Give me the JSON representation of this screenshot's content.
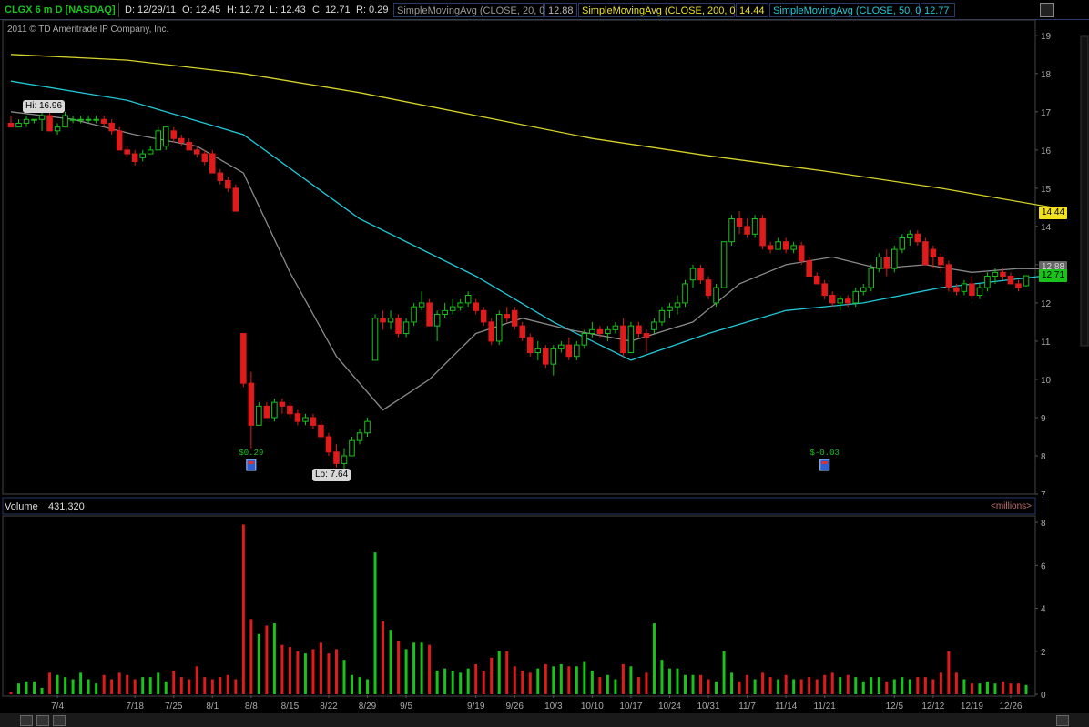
{
  "header": {
    "symbol": "CLGX 6 m D [NASDAQ]",
    "date": "D: 12/29/11",
    "open": "O: 12.45",
    "high": "H: 12.72",
    "low": "L: 12.43",
    "close": "C: 12.71",
    "range": "R: 0.29",
    "sma20_label": "SimpleMovingAvg (CLOSE, 20, 0)",
    "sma20_value": "12.88",
    "sma200_label": "SimpleMovingAvg (CLOSE, 200, 0)",
    "sma200_value": "14.44",
    "sma50_label": "SimpleMovingAvg (CLOSE, 50, 0)",
    "sma50_value": "12.77"
  },
  "copyright": "2011 © TD Ameritrade IP Company, Inc.",
  "colors": {
    "up": "#19c319",
    "down": "#e01b1b",
    "sma20": "#8a8a8a",
    "sma50": "#22c8d8",
    "sma200": "#d6d22a",
    "grid": "#555555"
  },
  "volume_panel": {
    "label": "Volume",
    "value": "431,320",
    "units": "<millions>"
  },
  "annotations": {
    "hi_label": "Hi: 16.96",
    "lo_label": "Lo: 7.64",
    "earnings1": "$0.29",
    "earnings2": "$-0.03",
    "price_tag_200": "14.44",
    "price_tag_20": "12.88",
    "price_tag_close": "12.71"
  },
  "chart_data": {
    "type": "candlestick",
    "price_ylim": [
      7,
      19.4
    ],
    "price_yticks": [
      7,
      8,
      9,
      10,
      11,
      12,
      13,
      14,
      15,
      16,
      17,
      18,
      19
    ],
    "volume_ylim": [
      0,
      8.3
    ],
    "volume_yticks": [
      0,
      2,
      4,
      6,
      8
    ],
    "x_labels": [
      {
        "i": 6,
        "t": "7/4"
      },
      {
        "i": 16,
        "t": "7/18"
      },
      {
        "i": 21,
        "t": "7/25"
      },
      {
        "i": 26,
        "t": "8/1"
      },
      {
        "i": 31,
        "t": "8/8"
      },
      {
        "i": 36,
        "t": "8/15"
      },
      {
        "i": 41,
        "t": "8/22"
      },
      {
        "i": 46,
        "t": "8/29"
      },
      {
        "i": 51,
        "t": "9/5"
      },
      {
        "i": 60,
        "t": "9/19"
      },
      {
        "i": 65,
        "t": "9/26"
      },
      {
        "i": 70,
        "t": "10/3"
      },
      {
        "i": 75,
        "t": "10/10"
      },
      {
        "i": 80,
        "t": "10/17"
      },
      {
        "i": 85,
        "t": "10/24"
      },
      {
        "i": 90,
        "t": "10/31"
      },
      {
        "i": 95,
        "t": "11/7"
      },
      {
        "i": 100,
        "t": "11/14"
      },
      {
        "i": 105,
        "t": "11/21"
      },
      {
        "i": 114,
        "t": "12/5"
      },
      {
        "i": 119,
        "t": "12/12"
      },
      {
        "i": 124,
        "t": "12/19"
      },
      {
        "i": 129,
        "t": "12/26"
      }
    ],
    "candles": [
      [
        16.7,
        16.9,
        16.6,
        16.6,
        0.1
      ],
      [
        16.6,
        16.8,
        16.6,
        16.7,
        0.5
      ],
      [
        16.7,
        16.9,
        16.6,
        16.8,
        0.6
      ],
      [
        16.8,
        16.8,
        16.7,
        16.8,
        0.6
      ],
      [
        16.8,
        17.0,
        16.5,
        16.9,
        0.3
      ],
      [
        16.9,
        17.0,
        16.5,
        16.5,
        1.0
      ],
      [
        16.5,
        16.7,
        16.4,
        16.6,
        0.9
      ],
      [
        16.6,
        17.0,
        16.6,
        16.9,
        0.8
      ],
      [
        16.8,
        16.9,
        16.7,
        16.8,
        0.7
      ],
      [
        16.8,
        16.9,
        16.7,
        16.8,
        1.0
      ],
      [
        16.8,
        16.9,
        16.7,
        16.8,
        0.7
      ],
      [
        16.8,
        16.9,
        16.7,
        16.8,
        0.5
      ],
      [
        16.8,
        16.9,
        16.6,
        16.7,
        0.9
      ],
      [
        16.7,
        16.8,
        16.4,
        16.5,
        0.7
      ],
      [
        16.5,
        16.6,
        16.0,
        16.0,
        1.0
      ],
      [
        16.0,
        16.1,
        15.8,
        15.9,
        0.9
      ],
      [
        15.9,
        16.0,
        15.6,
        15.7,
        0.7
      ],
      [
        15.8,
        16.0,
        15.7,
        15.9,
        0.8
      ],
      [
        15.9,
        16.1,
        15.9,
        16.0,
        0.8
      ],
      [
        16.0,
        16.6,
        16.0,
        16.5,
        1.0
      ],
      [
        16.1,
        16.6,
        16.0,
        16.6,
        0.6
      ],
      [
        16.5,
        16.6,
        16.2,
        16.3,
        1.1
      ],
      [
        16.3,
        16.4,
        16.1,
        16.2,
        0.8
      ],
      [
        16.2,
        16.3,
        16.0,
        16.0,
        0.7
      ],
      [
        16.0,
        16.1,
        15.8,
        15.9,
        1.3
      ],
      [
        15.9,
        16.0,
        15.6,
        15.7,
        0.8
      ],
      [
        15.9,
        16.0,
        15.4,
        15.4,
        0.7
      ],
      [
        15.4,
        15.5,
        15.1,
        15.2,
        0.8
      ],
      [
        15.2,
        15.3,
        14.9,
        15.0,
        0.9
      ],
      [
        15.0,
        15.1,
        14.4,
        14.4,
        0.7
      ],
      [
        11.2,
        11.2,
        9.8,
        9.9,
        7.9
      ],
      [
        9.9,
        10.2,
        8.2,
        8.8,
        3.5
      ],
      [
        8.8,
        9.4,
        8.8,
        9.3,
        2.8
      ],
      [
        9.3,
        9.4,
        9.0,
        9.0,
        3.2
      ],
      [
        9.0,
        9.5,
        8.9,
        9.4,
        3.3
      ],
      [
        9.4,
        9.5,
        9.1,
        9.3,
        2.3
      ],
      [
        9.3,
        9.4,
        9.0,
        9.1,
        2.2
      ],
      [
        9.1,
        9.2,
        8.8,
        8.9,
        2.0
      ],
      [
        8.9,
        9.1,
        8.8,
        9.0,
        1.9
      ],
      [
        9.0,
        9.1,
        8.7,
        8.8,
        2.1
      ],
      [
        8.8,
        8.9,
        8.5,
        8.5,
        2.4
      ],
      [
        8.5,
        8.6,
        8.0,
        8.1,
        1.9
      ],
      [
        8.1,
        8.3,
        7.7,
        7.8,
        2.1
      ],
      [
        7.8,
        8.2,
        7.6,
        8.0,
        1.6
      ],
      [
        8.0,
        8.5,
        8.0,
        8.4,
        0.9
      ],
      [
        8.4,
        8.7,
        8.3,
        8.6,
        0.8
      ],
      [
        8.6,
        9.0,
        8.5,
        8.9,
        0.7
      ],
      [
        10.5,
        11.7,
        10.5,
        11.6,
        6.6
      ],
      [
        11.6,
        11.8,
        11.3,
        11.5,
        3.4
      ],
      [
        11.5,
        11.8,
        11.3,
        11.6,
        3.0
      ],
      [
        11.6,
        11.7,
        11.1,
        11.2,
        2.5
      ],
      [
        11.2,
        11.6,
        11.1,
        11.5,
        2.1
      ],
      [
        11.5,
        12.0,
        11.4,
        11.9,
        2.4
      ],
      [
        11.9,
        12.3,
        11.8,
        12.0,
        2.4
      ],
      [
        12.0,
        12.1,
        11.4,
        11.4,
        2.3
      ],
      [
        11.4,
        11.8,
        11.0,
        11.7,
        1.1
      ],
      [
        11.7,
        12.0,
        11.6,
        11.8,
        1.2
      ],
      [
        11.8,
        12.1,
        11.7,
        11.9,
        1.1
      ],
      [
        11.9,
        12.1,
        11.8,
        12.0,
        1.0
      ],
      [
        12.0,
        12.3,
        11.9,
        12.2,
        1.2
      ],
      [
        12.0,
        12.1,
        11.7,
        11.8,
        1.4
      ],
      [
        11.8,
        11.9,
        11.4,
        11.5,
        1.1
      ],
      [
        11.5,
        11.6,
        10.9,
        11.0,
        1.7
      ],
      [
        11.0,
        11.8,
        10.9,
        11.7,
        2.0
      ],
      [
        11.7,
        11.9,
        11.5,
        11.6,
        2.0
      ],
      [
        11.8,
        11.9,
        11.3,
        11.4,
        1.3
      ],
      [
        11.4,
        11.5,
        11.0,
        11.1,
        1.1
      ],
      [
        11.1,
        11.2,
        10.6,
        10.7,
        1.0
      ],
      [
        10.7,
        11.0,
        10.5,
        10.8,
        1.2
      ],
      [
        10.8,
        10.9,
        10.3,
        10.4,
        1.4
      ],
      [
        10.4,
        10.9,
        10.1,
        10.8,
        1.3
      ],
      [
        10.8,
        11.0,
        10.7,
        10.9,
        1.4
      ],
      [
        10.9,
        11.1,
        10.5,
        10.6,
        1.3
      ],
      [
        10.6,
        11.0,
        10.5,
        10.9,
        1.3
      ],
      [
        10.9,
        11.3,
        10.8,
        11.2,
        1.5
      ],
      [
        11.2,
        11.5,
        11.1,
        11.3,
        1.1
      ],
      [
        11.3,
        11.4,
        11.1,
        11.2,
        0.8
      ],
      [
        11.2,
        11.4,
        11.0,
        11.3,
        0.9
      ],
      [
        11.3,
        11.5,
        11.2,
        11.4,
        0.7
      ],
      [
        11.4,
        11.6,
        10.6,
        10.7,
        1.4
      ],
      [
        10.7,
        11.5,
        10.7,
        11.4,
        1.3
      ],
      [
        11.4,
        11.5,
        11.1,
        11.2,
        0.8
      ],
      [
        11.2,
        11.3,
        10.7,
        11.1,
        1.0
      ],
      [
        11.3,
        11.6,
        11.2,
        11.5,
        3.3
      ],
      [
        11.5,
        11.9,
        11.4,
        11.8,
        1.6
      ],
      [
        11.8,
        12.0,
        11.6,
        11.9,
        1.2
      ],
      [
        11.9,
        12.2,
        11.7,
        12.0,
        1.2
      ],
      [
        12.0,
        12.6,
        11.9,
        12.5,
        0.9
      ],
      [
        12.6,
        13.0,
        12.4,
        12.9,
        0.9
      ],
      [
        12.9,
        13.0,
        12.5,
        12.6,
        0.9
      ],
      [
        12.6,
        12.7,
        12.1,
        12.2,
        0.7
      ],
      [
        12.0,
        12.5,
        11.9,
        12.4,
        0.6
      ],
      [
        12.4,
        13.6,
        12.4,
        13.6,
        2.0
      ],
      [
        13.6,
        14.3,
        13.5,
        14.2,
        1.0
      ],
      [
        14.2,
        14.4,
        13.8,
        14.0,
        0.6
      ],
      [
        14.0,
        14.2,
        13.7,
        13.8,
        0.9
      ],
      [
        13.8,
        14.3,
        13.7,
        14.2,
        0.7
      ],
      [
        14.2,
        14.3,
        13.4,
        13.5,
        1.0
      ],
      [
        13.5,
        13.6,
        13.3,
        13.4,
        0.8
      ],
      [
        13.4,
        13.7,
        13.4,
        13.6,
        0.7
      ],
      [
        13.6,
        13.7,
        13.3,
        13.4,
        0.9
      ],
      [
        13.4,
        13.6,
        13.3,
        13.5,
        0.7
      ],
      [
        13.5,
        13.6,
        13.0,
        13.1,
        0.7
      ],
      [
        13.1,
        13.2,
        12.7,
        12.7,
        0.8
      ],
      [
        12.7,
        12.8,
        12.5,
        12.5,
        0.7
      ],
      [
        12.5,
        12.6,
        12.1,
        12.2,
        0.9
      ],
      [
        12.2,
        12.3,
        11.9,
        12.0,
        1.0
      ],
      [
        12.0,
        12.2,
        11.8,
        12.1,
        0.8
      ],
      [
        12.1,
        12.2,
        11.9,
        12.0,
        0.9
      ],
      [
        12.0,
        12.4,
        11.9,
        12.3,
        0.8
      ],
      [
        12.3,
        12.5,
        12.2,
        12.4,
        0.6
      ],
      [
        12.4,
        13.0,
        12.3,
        12.9,
        0.8
      ],
      [
        12.9,
        13.3,
        12.8,
        13.2,
        0.8
      ],
      [
        13.2,
        13.4,
        12.7,
        12.9,
        0.6
      ],
      [
        12.9,
        13.5,
        12.8,
        13.4,
        0.7
      ],
      [
        13.4,
        13.8,
        13.3,
        13.7,
        0.8
      ],
      [
        13.7,
        13.9,
        13.5,
        13.8,
        0.7
      ],
      [
        13.8,
        13.9,
        13.5,
        13.6,
        0.8
      ],
      [
        13.6,
        13.7,
        13.0,
        13.0,
        0.8
      ],
      [
        13.4,
        13.5,
        12.9,
        13.2,
        0.7
      ],
      [
        13.2,
        13.3,
        12.8,
        13.0,
        1.0
      ],
      [
        13.0,
        13.1,
        12.3,
        12.4,
        2.0
      ],
      [
        12.4,
        12.5,
        12.2,
        12.3,
        1.0
      ],
      [
        12.3,
        12.6,
        12.2,
        12.5,
        0.7
      ],
      [
        12.5,
        12.7,
        12.1,
        12.2,
        0.5
      ],
      [
        12.2,
        12.5,
        12.1,
        12.4,
        0.5
      ],
      [
        12.4,
        12.8,
        12.3,
        12.7,
        0.6
      ],
      [
        12.7,
        12.9,
        12.5,
        12.8,
        0.5
      ],
      [
        12.8,
        12.9,
        12.6,
        12.7,
        0.6
      ],
      [
        12.7,
        12.8,
        12.5,
        12.5,
        0.5
      ],
      [
        12.5,
        12.6,
        12.3,
        12.4,
        0.5
      ],
      [
        12.45,
        12.72,
        12.43,
        12.71,
        0.43
      ]
    ],
    "sma200": [
      [
        0,
        18.5
      ],
      [
        15,
        18.35
      ],
      [
        30,
        18.0
      ],
      [
        45,
        17.5
      ],
      [
        60,
        16.9
      ],
      [
        75,
        16.3
      ],
      [
        90,
        15.85
      ],
      [
        105,
        15.45
      ],
      [
        120,
        15.0
      ],
      [
        136,
        14.44
      ]
    ],
    "sma50": [
      [
        0,
        17.8
      ],
      [
        15,
        17.3
      ],
      [
        30,
        16.4
      ],
      [
        45,
        14.2
      ],
      [
        60,
        12.7
      ],
      [
        70,
        11.5
      ],
      [
        80,
        10.5
      ],
      [
        90,
        11.2
      ],
      [
        100,
        11.8
      ],
      [
        110,
        12.0
      ],
      [
        120,
        12.4
      ],
      [
        136,
        12.77
      ]
    ],
    "sma20": [
      [
        0,
        17.0
      ],
      [
        8,
        16.8
      ],
      [
        16,
        16.4
      ],
      [
        24,
        16.1
      ],
      [
        30,
        15.4
      ],
      [
        36,
        12.8
      ],
      [
        42,
        10.6
      ],
      [
        48,
        9.2
      ],
      [
        54,
        10.0
      ],
      [
        60,
        11.2
      ],
      [
        66,
        11.6
      ],
      [
        72,
        11.3
      ],
      [
        80,
        11.0
      ],
      [
        88,
        11.5
      ],
      [
        94,
        12.5
      ],
      [
        100,
        13.0
      ],
      [
        106,
        13.2
      ],
      [
        112,
        12.9
      ],
      [
        118,
        13.0
      ],
      [
        124,
        12.8
      ],
      [
        130,
        12.9
      ],
      [
        136,
        12.88
      ]
    ],
    "earnings": [
      {
        "i": 31,
        "key": "earnings1"
      },
      {
        "i": 105,
        "key": "earnings2"
      }
    ]
  }
}
